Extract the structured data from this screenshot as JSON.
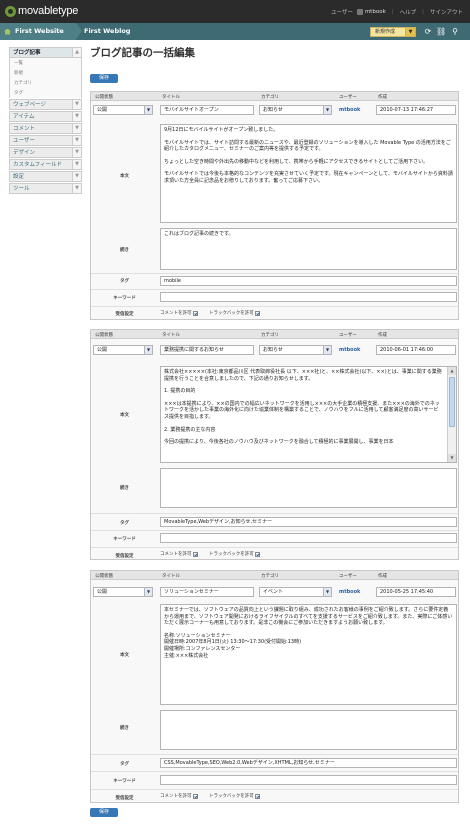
{
  "header": {
    "logo": "movabletype",
    "user_label": "ユーザー",
    "user_name": "mtbook",
    "help": "ヘルプ",
    "signout": "サインアウト"
  },
  "nav": {
    "site": "First Website",
    "blog": "First Weblog",
    "new_label": "新規作成"
  },
  "sidebar": {
    "active": "ブログ記事",
    "subitems": [
      "一覧",
      "新規",
      "カテゴリ",
      "タグ"
    ],
    "groups": [
      "ウェブページ",
      "アイテム",
      "コメント",
      "ユーザー",
      "デザイン",
      "カスタムフィールド",
      "設定",
      "ツール"
    ]
  },
  "page_title": "ブログ記事の一括編集",
  "save_label": "保存",
  "labels": {
    "status": "公開状態",
    "title": "タイトル",
    "category": "カテゴリ",
    "user": "ユーザー",
    "created": "作成",
    "body": "本文",
    "more": "続き",
    "tags": "タグ",
    "keywords": "キーワード",
    "receive": "受信設定",
    "allow_comments": "コメントを許可",
    "allow_trackbacks": "トラックバックを許可"
  },
  "entries": [
    {
      "status": "公開",
      "title": "モバイルサイトオープン",
      "category": "お知らせ",
      "author": "mtbook",
      "created": "2010-07-13 17:46:27",
      "body": [
        "9月12日にモバイルサイトがオープン致しました。",
        "モバイルサイトでは、サイト訪問する最新のニュースや、最近登録のソリューションを導入した Movable Type の活用方法をご紹介したカタログメニュー、セミナーのご案内等を提供する予定です。",
        "ちょっとした空き時間や外出先の移動中などを利用して、携帯から手軽にアクセスできるサイトとしてご活用下さい。",
        "モバイルサイトでは今後も本格的なコンテンツを充実させていく予定です。現在キャンペーンとして、モバイルサイトから資料請求頂いた方全員に記念品をお贈りしております。奮ってご応募下さい。"
      ],
      "more": "これはブログ記事の続きです。",
      "tags": "mobile",
      "keywords": ""
    },
    {
      "status": "公開",
      "title": "業務提携に関するお知らせ",
      "category": "お知らせ",
      "author": "mtbook",
      "created": "2010-06-01 17:46:00",
      "body": [
        "株式会社×××××(本社:東京都品川区 代表取締役社長 以下、×××社)と、××株式会社(以下、××)とは、事業に関する業務提携を行うことを合意しましたので、下記の通りお知らせします。",
        "1. 提携の目的",
        "×××は本提携により、××の国内での幅広いネットワークを活用し×××の大手企業の積極支援、また×××の海外でのネットワークを活かした事業の海外化に向けた協業体制を構築することで、ノウハウをフルに活用して顧客満足度の高いサービス提供を目指します。",
        "2. 業務提携の主な内容",
        "今回の提携により、今後各社のノウハウ及びネットワークを融合して積極的に事業展開し、事業を日本"
      ],
      "more": "",
      "tags": "MovableType,Webデザイン,お知らせ,セミナー",
      "keywords": ""
    },
    {
      "status": "公開",
      "title": "ソリューションセミナー",
      "category": "イベント",
      "author": "mtbook",
      "created": "2010-05-25 17:45:40",
      "body": [
        "本セミナーでは、ソフトウェアの品質向上という課題に取り組み、成功されたお客様の事例をご紹介致します。さらに要件定義から運用まで、ソフトウェア開発におけるライフサイクルのすべてを支援するサービスをご紹介致します。また、実際にご体感いただく展示コーナーも用意しております。是非この機会にご参加いただきますようお願い致します。",
        "名称:ソリューションセミナー\n開催日時:2007年8月1日(火) 13:30〜17:30(受付開始:13時)\n開催場所:コンファレンスセンター\n主催:×××株式会社"
      ],
      "more": "",
      "tags": "CSS,MovableType,SEO,Web2.0,Webデザイン,XHTML,お知らせ,セミナー",
      "keywords": ""
    }
  ]
}
